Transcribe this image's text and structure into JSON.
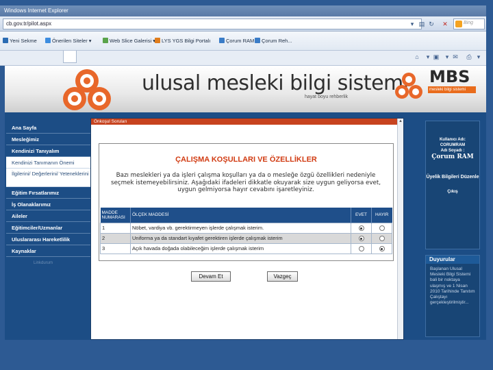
{
  "browser": {
    "title": "Windows Internet Explorer",
    "url": "cb.gov.tr/pilot.aspx",
    "search_placeholder": "Bing",
    "favorites": [
      {
        "label": "Yeni Sekme",
        "color": "#2b6cb3"
      },
      {
        "label": "Önerilen Siteler ▾",
        "color": "#3d8de0"
      },
      {
        "label": "Web Slice Galerisi ▾",
        "color": "#5aa34a"
      },
      {
        "label": "LYS YGS Bilgi Portalı",
        "color": "#e07d1c"
      },
      {
        "label": "Çorum RAM",
        "color": "#3a7cc7"
      },
      {
        "label": "Çorum Reh...",
        "color": "#3a7cc7"
      }
    ]
  },
  "site": {
    "title": "ulusal mesleki bilgi sistemi",
    "slogan": "hayat boyu rehberlik",
    "brand": "MBS",
    "brand_sub": "mesleki bilgi sistemi"
  },
  "leftnav": {
    "items": [
      {
        "label": "Ana Sayfa",
        "type": "main"
      },
      {
        "label": "Mesleğimiz",
        "type": "main"
      },
      {
        "label": "Kendinizi Tanıyalım",
        "type": "main"
      },
      {
        "label": "Kendinizi Tanımanın Önemi",
        "type": "sub"
      },
      {
        "label": "İlgilerini/ Değerlerini/ Yeteneklerini Keşfet",
        "type": "sub2"
      },
      {
        "label": "Eğitim Fırsatlarımız",
        "type": "main"
      },
      {
        "label": "İş Olanaklarımız",
        "type": "main"
      },
      {
        "label": "Aileler",
        "type": "main"
      },
      {
        "label": "Eğitimciler/Uzmanlar",
        "type": "main"
      },
      {
        "label": "Uluslararası Hareketlilik",
        "type": "main"
      },
      {
        "label": "Kaynaklar",
        "type": "main"
      }
    ],
    "footer": "Linkdurum"
  },
  "center": {
    "header": "Önkoşul Soruları",
    "title": "ÇALIŞMA KOŞULLARI VE ÖZELLİKLER",
    "description": "Bazı meslekleri ya da işleri çalışma koşulları ya da o mesleğe özgü özellikleri nedeniyle seçmek istemeyebilirsiniz. Aşağıdaki ifadeleri dikkatle okuyarak size uygun geliyorsa evet, uygun gelmiyorsa hayır cevabını işaretleyiniz.",
    "table": {
      "headers": {
        "no": "MADDE NUMARASI",
        "item": "ÖLÇEK MADDESİ",
        "yes": "EVET",
        "no_ans": "HAYIR"
      },
      "rows": [
        {
          "no": "1",
          "text": "Nöbet, vardiya vb. gerektirmeyen işlerde çalışmak isterim.",
          "answer": "yes"
        },
        {
          "no": "2",
          "text": "Uniforma ya da standart kıyafet gerektiren işlerde çalışmak isterim",
          "answer": "yes"
        },
        {
          "no": "3",
          "text": "Açık havada doğada olabileceğim işlerde çalışmak isterim",
          "answer": "no"
        }
      ]
    },
    "continue_label": "Devam Et",
    "cancel_label": "Vazgeç"
  },
  "rightpanel": {
    "user_label": "Kullanıcı Adı:",
    "user_value": "CORUMRAM",
    "name_label": "Adı Soyadı :",
    "name_value": "Çorum RAM",
    "info_label": "Üyelik Bilgileri Düzenle",
    "logout_label": "Çıkış"
  },
  "announcements": {
    "title": "Duyurular",
    "text": "Başlanan Ulusal Mesleki Bilgi Sistemi bali bir noktaya ulaşmış ve 1 Nisan 2010 Tarihinde Tanıtım Çalıştayı gerçekleştirilmiştir..."
  }
}
